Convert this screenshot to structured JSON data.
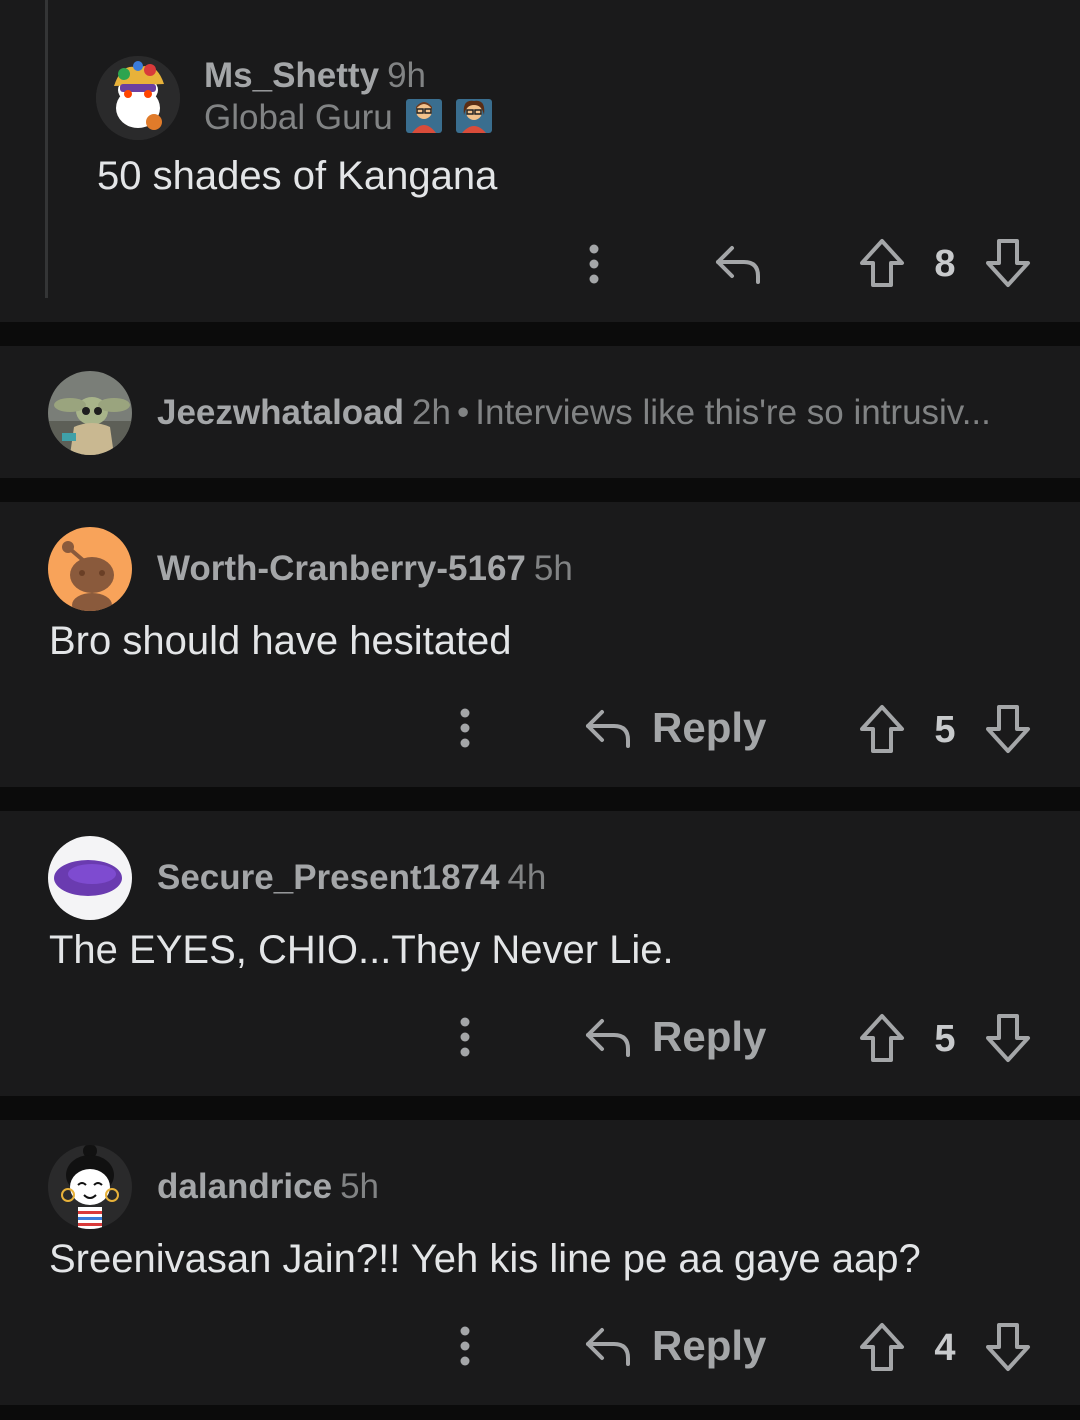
{
  "comments": [
    {
      "username": "Ms_Shetty",
      "time": "9h",
      "flair": "Global Guru",
      "body": "50 shades of Kangana",
      "votes": "8"
    },
    {
      "username": "Jeezwhataload",
      "time": "2h",
      "separator": "•",
      "preview": "Interviews like this're so intrusiv..."
    },
    {
      "username": "Worth-Cranberry-5167",
      "time": "5h",
      "body": "Bro should have hesitated",
      "reply_label": "Reply",
      "votes": "5"
    },
    {
      "username": "Secure_Present1874",
      "time": "4h",
      "body": "The EYES, CHIO...They Never Lie.",
      "reply_label": "Reply",
      "votes": "5"
    },
    {
      "username": "dalandrice",
      "time": "5h",
      "body": "Sreenivasan Jain?!! Yeh kis line pe aa gaye aap?",
      "reply_label": "Reply",
      "votes": "4"
    }
  ],
  "icons": {
    "more": "more-vertical-icon",
    "reply": "reply-arrow-icon",
    "upvote": "upvote-arrow-icon",
    "downvote": "downvote-arrow-icon"
  },
  "colors": {
    "background": "#0b0b0b",
    "card": "#1a1a1b",
    "text": "#e3e5e7",
    "muted": "#818384"
  }
}
